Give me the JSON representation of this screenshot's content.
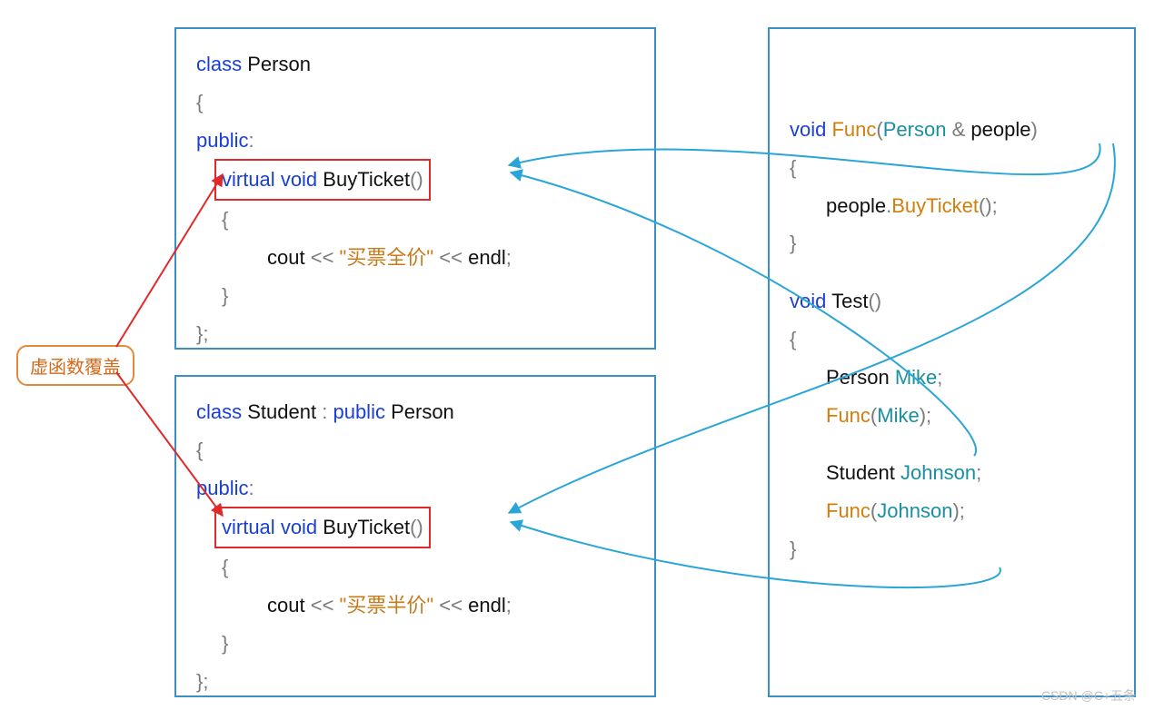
{
  "callout": {
    "label": "虚函数覆盖"
  },
  "person": {
    "line1_kw": "class",
    "line1_name": "Person",
    "brace_open": "{",
    "public_kw": "public",
    "public_colon": ":",
    "fn_kw_virtual": "virtual",
    "fn_kw_void": "void",
    "fn_name": "BuyTicket",
    "fn_parens": "()",
    "fn_brace_open": "{",
    "cout_kw": "cout",
    "op1": "<<",
    "str": "\"买票全价\"",
    "op2": "<<",
    "endl": "endl",
    "semi": ";",
    "fn_brace_close": "}",
    "brace_close": "};"
  },
  "student": {
    "line1_kw": "class",
    "line1_name": "Student",
    "colon": ":",
    "pub_kw": "public",
    "base": "Person",
    "brace_open": "{",
    "public_kw": "public",
    "public_colon": ":",
    "fn_kw_virtual": "virtual",
    "fn_kw_void": "void",
    "fn_name": "BuyTicket",
    "fn_parens": "()",
    "fn_brace_open": "{",
    "cout_kw": "cout",
    "op1": "<<",
    "str": "\"买票半价\"",
    "op2": "<<",
    "endl": "endl",
    "semi": ";",
    "fn_brace_close": "}",
    "brace_close": "};"
  },
  "right": {
    "func_kw_void": "void",
    "func_name": "Func",
    "func_open": "(",
    "func_type": "Person",
    "amp": "&",
    "func_param": "people",
    "func_close": ")",
    "func_brace_open": "{",
    "call_obj": "people",
    "dot": ".",
    "call_meth": "BuyTicket",
    "call_paren": "();",
    "func_brace_close": "}",
    "test_kw_void": "void",
    "test_name": "Test",
    "test_parens": "()",
    "test_brace_open": "{",
    "p_type": "Person",
    "p_name": "Mike",
    "p_semi": ";",
    "call1_fn": "Func",
    "call1_open": "(",
    "call1_arg": "Mike",
    "call1_close": ");",
    "s_type": "Student",
    "s_name": "Johnson",
    "s_semi": ";",
    "call2_fn": "Func",
    "call2_open": "(",
    "call2_arg": "Johnson",
    "call2_close": ");",
    "test_brace_close": "}"
  },
  "footer": {
    "watermark": "CSDN @C+五条"
  },
  "colors": {
    "box_border": "#3a8fc7",
    "red_box": "#e02a2a",
    "arrow_red": "#e02a2a",
    "arrow_blue": "#2aa5d8",
    "callout_border": "#e38a3a"
  }
}
